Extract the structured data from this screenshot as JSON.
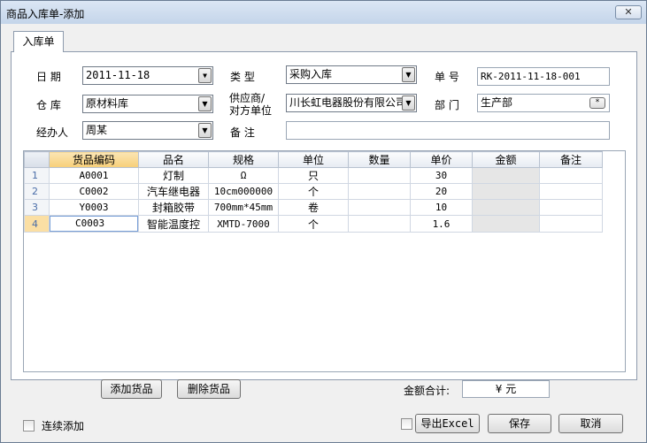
{
  "window": {
    "title": "商品入库单-添加",
    "close_glyph": "✕"
  },
  "tab": {
    "label": "入库单"
  },
  "form": {
    "date_label": "日  期",
    "date_value": "2011-11-18",
    "type_label": "类  型",
    "type_value": "采购入库",
    "number_label": "单  号",
    "number_value": "RK-2011-11-18-001",
    "warehouse_label": "仓  库",
    "warehouse_value": "原材料库",
    "supplier_label_line1": "供应商/",
    "supplier_label_line2": "对方单位",
    "supplier_value": "川长虹电器股份有限公司",
    "dept_label": "部  门",
    "dept_value": "生产部",
    "dept_button": "*",
    "handler_label": "经办人",
    "handler_value": "周某",
    "remark_label": "备  注",
    "remark_value": ""
  },
  "grid": {
    "columns": [
      "货品编码",
      "品名",
      "规格",
      "单位",
      "数量",
      "单价",
      "金额",
      "备注"
    ],
    "rows": [
      {
        "num": "1",
        "code": "A0001",
        "name": "灯制",
        "spec": "Ω",
        "unit": "只",
        "qty": "",
        "price": "30",
        "amount": "",
        "note": ""
      },
      {
        "num": "2",
        "code": "C0002",
        "name": "汽车继电器",
        "spec": "10cm000000",
        "unit": "个",
        "qty": "",
        "price": "20",
        "amount": "",
        "note": ""
      },
      {
        "num": "3",
        "code": "Y0003",
        "name": "封箱胶带",
        "spec": "700mm*45mm",
        "unit": "卷",
        "qty": "",
        "price": "10",
        "amount": "",
        "note": ""
      },
      {
        "num": "4",
        "code": "C0003",
        "name": "智能温度控",
        "spec": "XMTD-7000",
        "unit": "个",
        "qty": "",
        "price": "1.6",
        "amount": "",
        "note": ""
      }
    ],
    "edit_button": "···"
  },
  "actions": {
    "add_goods": "添加货品",
    "delete_goods": "删除货品",
    "total_label": "金额合计:",
    "total_value": "¥  元",
    "continuous_add": "连续添加",
    "export_excel": "导出Excel",
    "save": "保存",
    "cancel": "取消"
  },
  "colors": {
    "title_bar": "#c4d5ea",
    "selected_header": "#f7cf78",
    "grey_cell": "#e6e6e6"
  }
}
